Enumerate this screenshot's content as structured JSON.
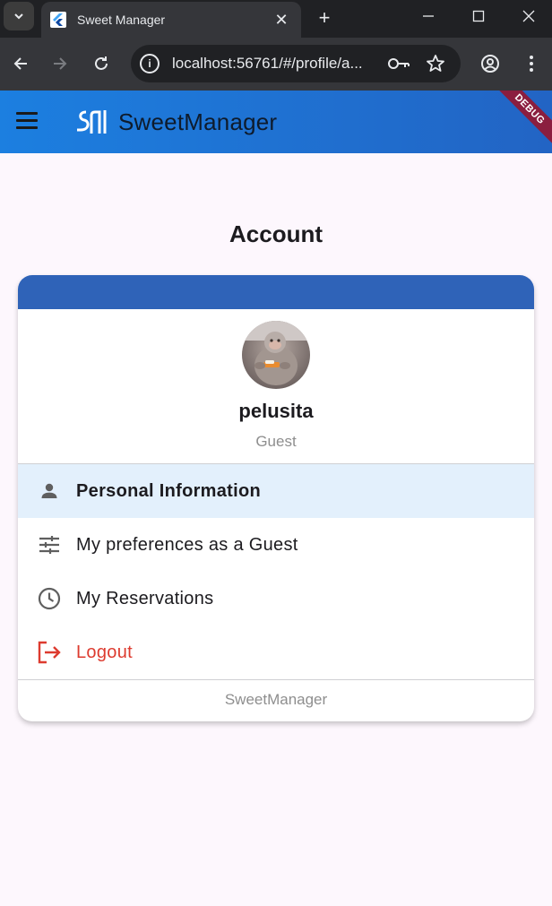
{
  "browser": {
    "tab_title": "Sweet Manager",
    "url": "localhost:56761/#/profile/a..."
  },
  "app": {
    "brand": "SweetManager",
    "debug_banner": "DEBUG",
    "primary_color": "#1c7fe0",
    "header_color": "#2f63b8"
  },
  "page": {
    "title": "Account"
  },
  "profile": {
    "username": "pelusita",
    "role": "Guest"
  },
  "menu": {
    "items": [
      {
        "label": "Personal Information",
        "icon": "person-icon",
        "active": true
      },
      {
        "label": "My preferences as a Guest",
        "icon": "tune-icon",
        "active": false
      },
      {
        "label": "My Reservations",
        "icon": "clock-icon",
        "active": false
      },
      {
        "label": "Logout",
        "icon": "logout-icon",
        "active": false,
        "color": "#dd3b2f"
      }
    ]
  },
  "footer": {
    "text": "SweetManager"
  }
}
